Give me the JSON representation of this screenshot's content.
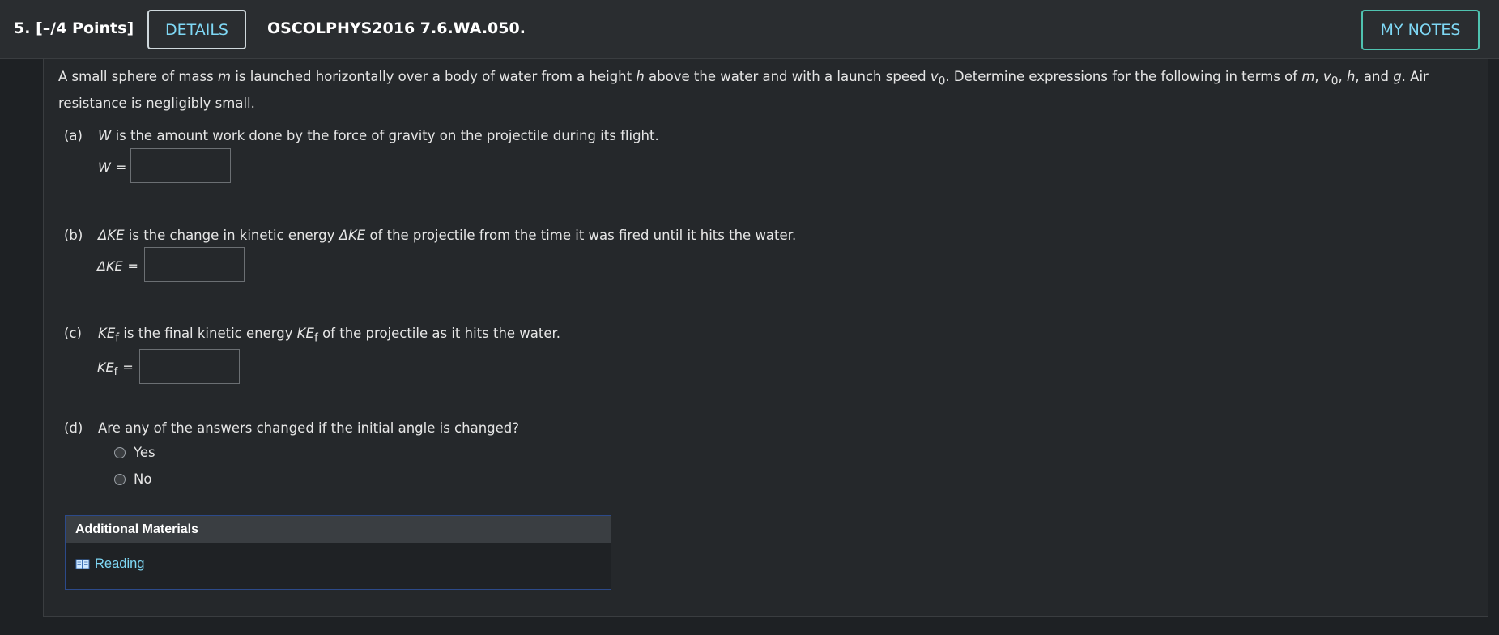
{
  "header": {
    "question_number": "5.",
    "points": "[–/4 Points]",
    "details_label": "DETAILS",
    "question_id": "OSCOLPHYS2016 7.6.WA.050.",
    "my_notes_label": "MY NOTES"
  },
  "intro": {
    "t1": "A small sphere of mass ",
    "m": "m",
    "t2": " is launched horizontally over a body of water from a height ",
    "h": "h",
    "t3": " above the water and with a launch speed ",
    "v": "v",
    "v_sub": "0",
    "t4": ". Determine expressions for the following in terms of ",
    "m2": "m",
    "sep1": ", ",
    "v2": "v",
    "v2_sub": "0",
    "sep2": ", ",
    "h2": "h",
    "t5": ", and ",
    "g": "g",
    "t6": ". Air resistance is negligibly small."
  },
  "parts": {
    "a": {
      "letter": "(a)",
      "var": "W",
      "text": " is the amount work done by the force of gravity on the projectile during its flight.",
      "label": "W",
      "eq": "=",
      "value": ""
    },
    "b": {
      "letter": "(b)",
      "var": "ΔKE",
      "text1": " is the change in kinetic energy ",
      "var2": "ΔKE",
      "text2": " of the projectile from the time it was fired until it hits the water.",
      "label": "ΔKE",
      "eq": "=",
      "value": ""
    },
    "c": {
      "letter": "(c)",
      "var": "KE",
      "var_sub": "f",
      "text1": " is the final kinetic energy ",
      "var2": "KE",
      "var2_sub": "f",
      "text2": " of the projectile as it hits the water.",
      "label": "KE",
      "label_sub": "f",
      "eq": "=",
      "value": ""
    },
    "d": {
      "letter": "(d)",
      "text": "Are any of the answers changed if the initial angle is changed?",
      "options": [
        "Yes",
        "No"
      ]
    }
  },
  "materials": {
    "title": "Additional Materials",
    "reading_label": "Reading",
    "icon": "book-icon"
  },
  "colors": {
    "link": "#7fd8f5",
    "notes_border": "#4fc3b0",
    "materials_border": "#2c4a8a"
  }
}
